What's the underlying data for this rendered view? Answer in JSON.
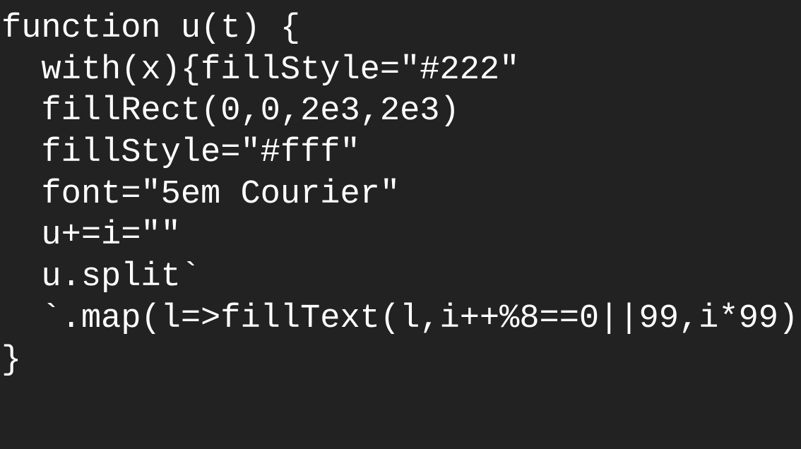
{
  "colors": {
    "background": "#222222",
    "text": "#ffffff"
  },
  "code_lines": [
    "function u(t) {",
    "  with(x){fillStyle=\"#222\"",
    "  fillRect(0,0,2e3,2e3)",
    "  fillStyle=\"#fff\"",
    "  font=\"5em Courier\"",
    "  u+=i=\"\"",
    "  u.split`",
    "  `.map(l=>fillText(l,i++%8==0||99,i*99)",
    "}"
  ]
}
